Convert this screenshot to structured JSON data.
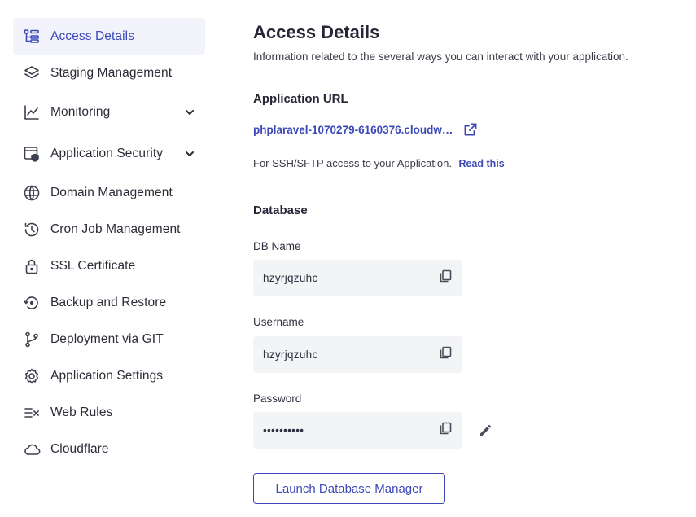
{
  "sidebar": {
    "items": [
      {
        "label": "Access Details",
        "icon": "access-details-icon",
        "active": true
      },
      {
        "label": "Staging Management",
        "icon": "layers-icon"
      },
      {
        "label": "Monitoring",
        "icon": "chart-line-icon",
        "expandable": true
      },
      {
        "label": "Application Security",
        "icon": "shield-browser-icon",
        "expandable": true
      },
      {
        "label": "Domain Management",
        "icon": "www-globe-icon"
      },
      {
        "label": "Cron Job Management",
        "icon": "history-clock-icon"
      },
      {
        "label": "SSL Certificate",
        "icon": "lock-icon"
      },
      {
        "label": "Backup and Restore",
        "icon": "backup-restore-icon"
      },
      {
        "label": "Deployment via GIT",
        "icon": "git-branch-icon"
      },
      {
        "label": "Application Settings",
        "icon": "gear-icon"
      },
      {
        "label": "Web Rules",
        "icon": "rules-list-icon"
      },
      {
        "label": "Cloudflare",
        "icon": "cloud-icon"
      }
    ]
  },
  "main": {
    "title": "Access Details",
    "subtitle": "Information related to the several ways you can interact with your application.",
    "app_url": {
      "heading": "Application URL",
      "url": "phplaravel-1070279-6160376.cloudw…",
      "ssh_text": "For SSH/SFTP access to your Application.",
      "ssh_link": "Read this"
    },
    "database": {
      "heading": "Database",
      "db_name_label": "DB Name",
      "db_name_value": "hzyrjqzuhc",
      "username_label": "Username",
      "username_value": "hzyrjqzuhc",
      "password_label": "Password",
      "password_value": "••••••••••",
      "launch_button": "Launch Database Manager"
    }
  },
  "colors": {
    "accent": "#3c48b8",
    "active_bg": "#f3f4fb",
    "field_bg": "#f3f4f6",
    "text": "#2b2c38"
  }
}
